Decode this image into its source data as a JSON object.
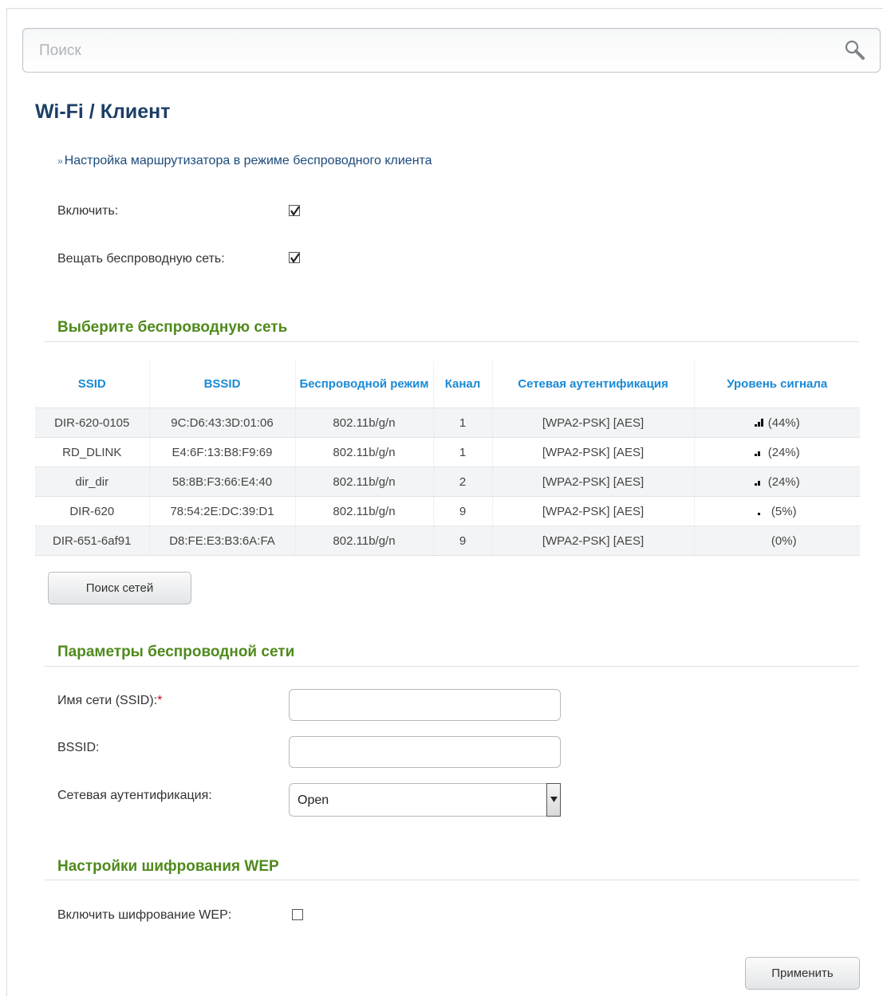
{
  "search": {
    "placeholder": "Поиск"
  },
  "page": {
    "title": "Wi-Fi /  Клиент"
  },
  "help_link": "Настройка маршрутизатора в режиме беспроводного клиента",
  "settings": {
    "enable_label": "Включить:",
    "enable_checked": true,
    "broadcast_label": "Вещать беспроводную сеть:",
    "broadcast_checked": true
  },
  "select_network": {
    "title": "Выберите беспроводную сеть",
    "columns": [
      "SSID",
      "BSSID",
      "Беспроводной режим",
      "Канал",
      "Сетевая аутентификация",
      "Уровень сигнала"
    ],
    "rows": [
      {
        "ssid": "DIR-620-0105",
        "bssid": "9C:D6:43:3D:01:06",
        "mode": "802.11b/g/n",
        "channel": "1",
        "auth": "[WPA2-PSK] [AES]",
        "signal": "(44%)",
        "signal_level": 0.44
      },
      {
        "ssid": "RD_DLINK",
        "bssid": "E4:6F:13:B8:F9:69",
        "mode": "802.11b/g/n",
        "channel": "1",
        "auth": "[WPA2-PSK] [AES]",
        "signal": "(24%)",
        "signal_level": 0.24
      },
      {
        "ssid": "dir_dir",
        "bssid": "58:8B:F3:66:E4:40",
        "mode": "802.11b/g/n",
        "channel": "2",
        "auth": "[WPA2-PSK] [AES]",
        "signal": "(24%)",
        "signal_level": 0.24
      },
      {
        "ssid": "DIR-620",
        "bssid": "78:54:2E:DC:39:D1",
        "mode": "802.11b/g/n",
        "channel": "9",
        "auth": "[WPA2-PSK] [AES]",
        "signal": "(5%)",
        "signal_level": 0.05
      },
      {
        "ssid": "DIR-651-6af91",
        "bssid": "D8:FE:E3:B3:6A:FA",
        "mode": "802.11b/g/n",
        "channel": "9",
        "auth": "[WPA2-PSK] [AES]",
        "signal": "(0%)",
        "signal_level": 0
      }
    ],
    "scan_button": "Поиск сетей"
  },
  "params": {
    "title": "Параметры беспроводной сети",
    "ssid_label": "Имя сети (SSID):",
    "required_mark": "*",
    "ssid_value": "",
    "bssid_label": "BSSID:",
    "bssid_value": "",
    "auth_label": "Сетевая аутентификация:",
    "auth_value": "Open"
  },
  "wep": {
    "title": "Настройки шифрования WEP",
    "enable_label": "Включить шифрование WEP:",
    "enable_checked": false
  },
  "apply_button": "Применить"
}
